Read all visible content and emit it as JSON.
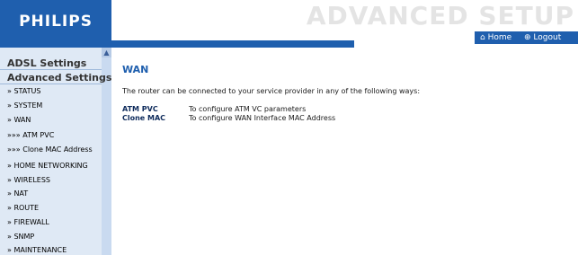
{
  "header": {
    "brand": "PHILIPS",
    "title": "ADVANCED SETUP",
    "nav": [
      {
        "icon": "home-icon",
        "label": "Home"
      },
      {
        "icon": "logout-icon",
        "label": "Logout"
      }
    ]
  },
  "sidebar": {
    "sections": [
      "ADSL Settings",
      "Advanced Settings"
    ],
    "items": [
      "» STATUS",
      "» SYSTEM",
      "» WAN",
      "»»» ATM PVC",
      "»»» Clone MAC Address",
      "» HOME NETWORKING",
      "» WIRELESS",
      "» NAT",
      "» ROUTE",
      "» FIREWALL",
      "» SNMP",
      "» MAINTENANCE"
    ]
  },
  "main": {
    "title": "WAN",
    "description": "The router can be connected to your service provider in any of the following ways:",
    "options": [
      {
        "name": "ATM PVC",
        "desc": "To configure ATM VC parameters"
      },
      {
        "name": "Clone MAC",
        "desc": "To configure WAN Interface MAC Address"
      }
    ]
  }
}
